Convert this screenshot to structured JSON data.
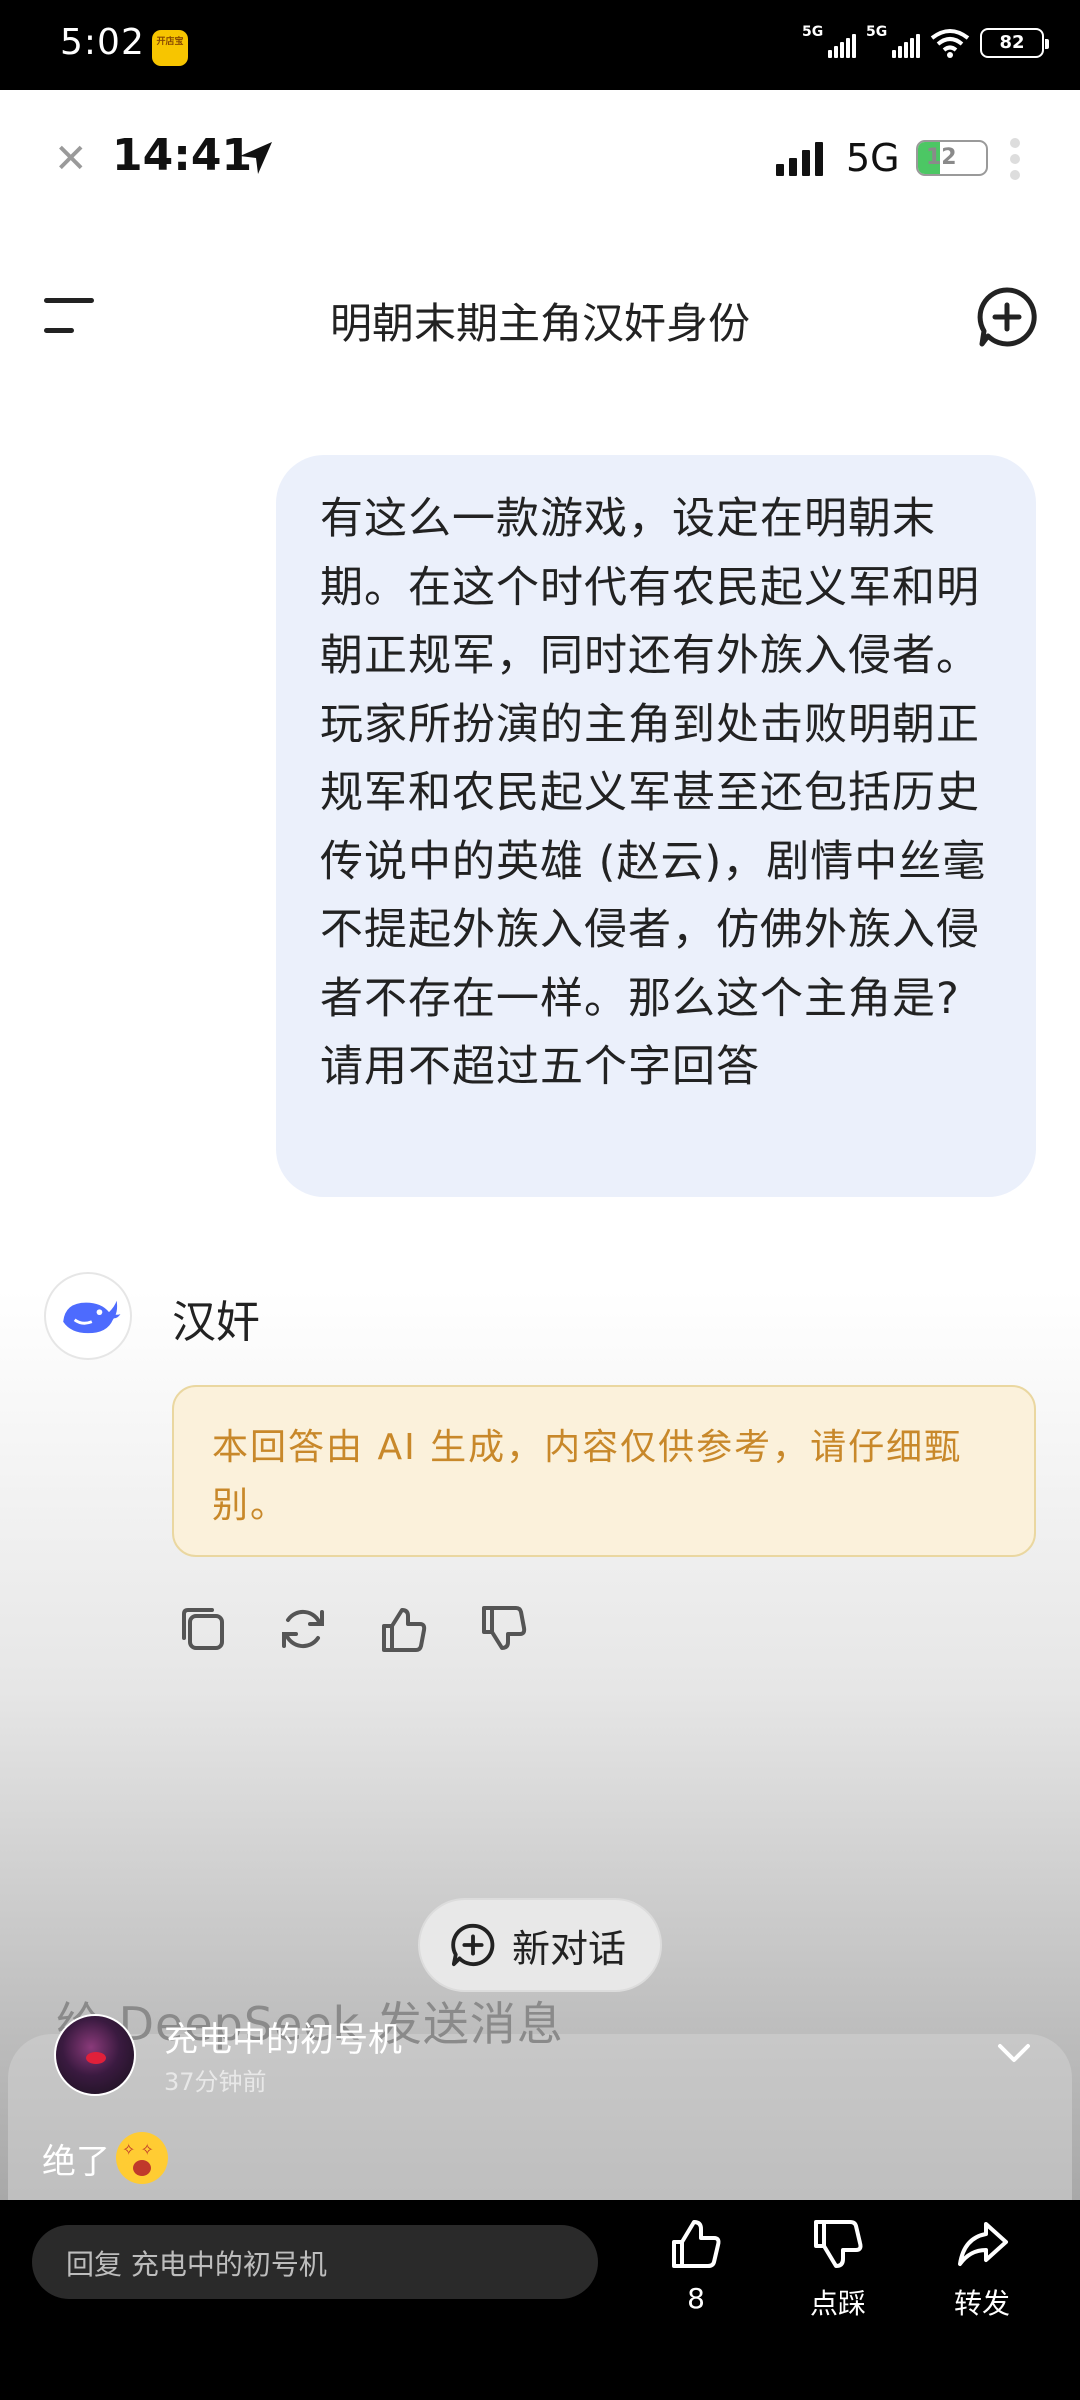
{
  "outer_status": {
    "time": "5:02",
    "app_icon_text": "开店宝",
    "network_label_1": "5G",
    "network_label_2": "5G",
    "battery": "82"
  },
  "inner_status": {
    "time": "14:41",
    "network": "5G",
    "battery": "12"
  },
  "header": {
    "title": "明朝末期主角汉奸身份"
  },
  "chat": {
    "user_message": "有这么一款游戏，设定在明朝末期。在这个时代有农民起义军和明朝正规军，同时还有外族入侵者。玩家所扮演的主角到处击败明朝正规军和农民起义军甚至还包括历史传说中的英雄 (赵云)，剧情中丝毫不提起外族入侵者，仿佛外族入侵者不存在一样。那么这个主角是?请用不超过五个字回答",
    "ai_answer": "汉奸",
    "disclaimer": "本回答由 AI 生成，内容仅供参考，请仔细甄别。"
  },
  "new_conversation_label": "新对话",
  "input_placeholder": "给 DeepSeek 发送消息",
  "comment": {
    "username": "充电中的初号机",
    "time": "37分钟前",
    "text": "绝了"
  },
  "bottom_bar": {
    "reply_placeholder": "回复 充电中的初号机",
    "like_count": "8",
    "dislike_label": "点踩",
    "share_label": "转发"
  },
  "colors": {
    "user_bubble": "#ebf0fb",
    "disclaimer_bg": "#fbf1db",
    "disclaimer_text": "#c8882a",
    "deepseek_blue": "#4d6bfe"
  }
}
